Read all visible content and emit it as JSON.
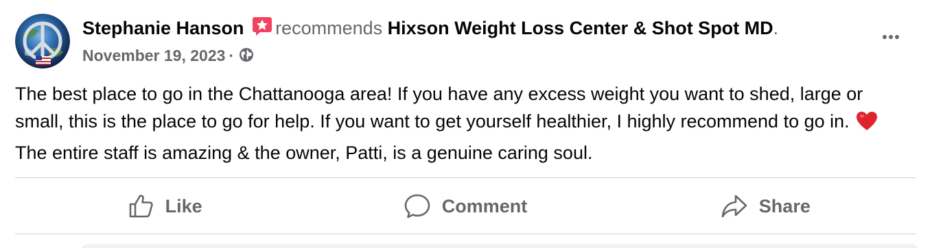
{
  "post": {
    "author": "Stephanie Hanson",
    "action_text": "recommends",
    "page_name": "Hixson Weight Loss Center & Shot Spot MD",
    "title_end": ".",
    "date": "November 19, 2023",
    "meta_separator": "·",
    "privacy_icon": "globe-icon",
    "recommend_badge_icon": "star-recommend-icon",
    "body_part1": "The best place to go in the Chattanooga area! If you have any excess weight you want to shed, large or small, this is the place to go for help. If you want to get yourself healthier, I highly recommend to go in.",
    "body_emoji": "red-heart-icon",
    "body_part2": "The entire staff is amazing & the owner, Patti, is a genuine caring soul."
  },
  "actions": {
    "like_label": "Like",
    "comment_label": "Comment",
    "share_label": "Share"
  },
  "colors": {
    "text_primary": "#050505",
    "text_secondary": "#65676b",
    "divider": "#ced0d4",
    "badge": "#f3425f",
    "heart": "#e0242d"
  }
}
